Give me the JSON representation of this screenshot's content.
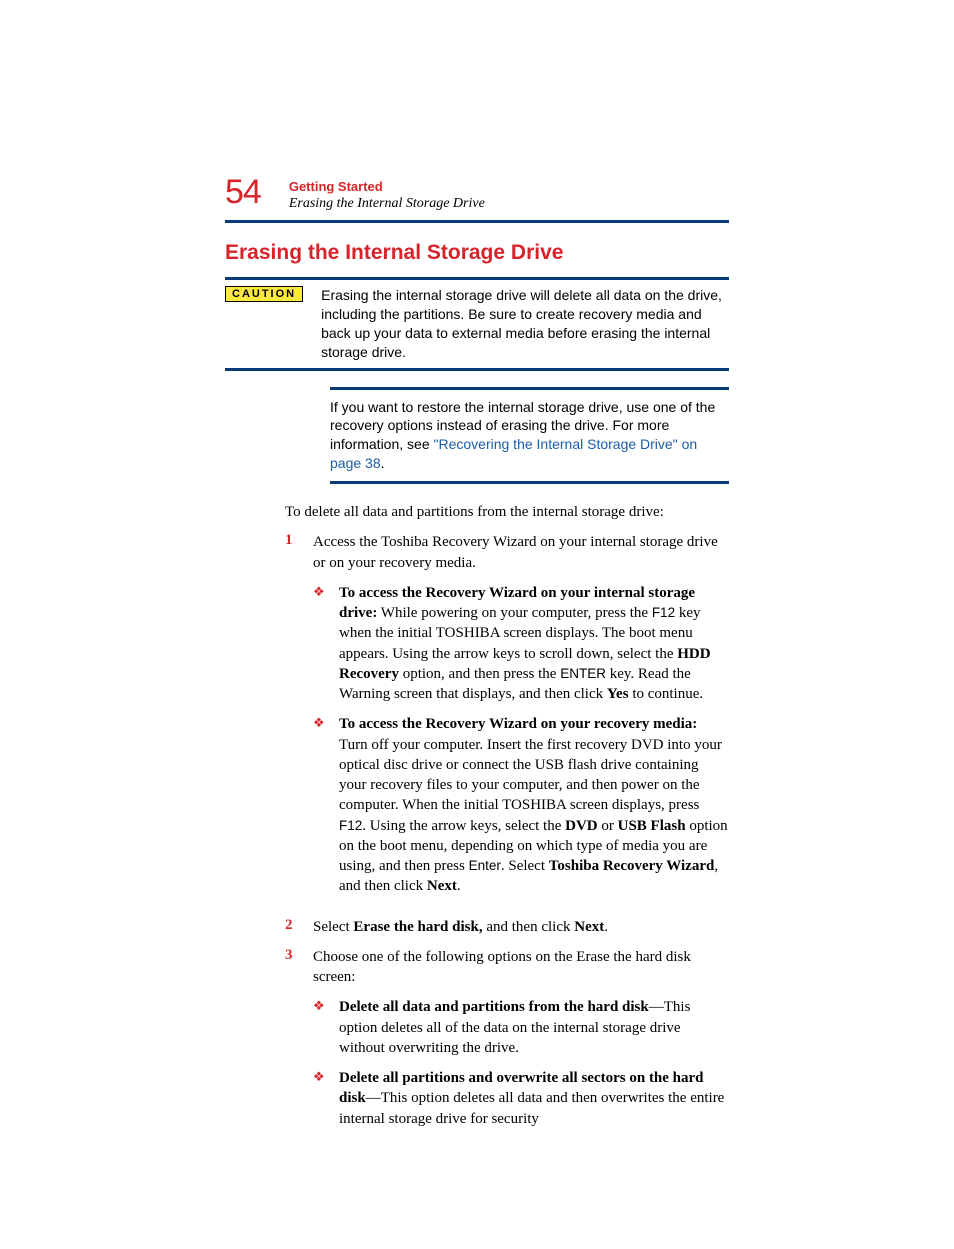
{
  "page_number": "54",
  "breadcrumb": "Getting Started",
  "subheading": "Erasing the Internal Storage Drive",
  "section_title": "Erasing the Internal Storage Drive",
  "caution": {
    "label": "CAUTION",
    "text": "Erasing the internal storage drive will delete all data on the drive, including the partitions. Be sure to create recovery media and back up your data to external media before erasing the internal storage drive."
  },
  "note": {
    "prefix": "If you want to restore the internal storage drive, use one of the recovery options instead of erasing the drive. For more information, see ",
    "link": "\"Recovering the Internal Storage Drive\" on page 38",
    "suffix": "."
  },
  "intro": "To delete all data and partitions from the internal storage drive:",
  "steps": {
    "s1": {
      "num": "1",
      "text": "Access the Toshiba Recovery Wizard on your internal storage drive or on your recovery media.",
      "sub_a": {
        "bold1": "To access the Recovery Wizard on your internal storage drive:",
        "t1": " While powering on your computer, press the ",
        "key1": "F12",
        "t2": " key when the initial TOSHIBA screen displays. The boot menu appears. Using the arrow keys to scroll down, select the ",
        "bold2": "HDD Recovery",
        "t3": " option, and then press the ",
        "key2": "ENTER",
        "t4": " key. Read the Warning screen that displays, and then click ",
        "bold3": "Yes",
        "t5": " to continue."
      },
      "sub_b": {
        "bold1": "To access the Recovery Wizard on your recovery media:",
        "t1": " Turn off your computer. Insert the first recovery DVD into your optical disc drive or connect the USB flash drive containing your recovery files to your computer, and then power on the computer. When the initial TOSHIBA screen displays, press ",
        "key1": "F12",
        "t2": ". Using the arrow keys, select the ",
        "bold2": "DVD",
        "t2b": " or ",
        "bold3": "USB Flash",
        "t3": " option on the boot menu, depending on which type of media you are using, and then press ",
        "key2": "Enter",
        "t4": ". Select ",
        "bold4": "Toshiba Recovery Wizard",
        "t5": ", and then click ",
        "bold5": "Next",
        "t6": "."
      }
    },
    "s2": {
      "num": "2",
      "t1": "Select ",
      "bold1": "Erase the hard disk,",
      "t2": " and then click ",
      "bold2": "Next",
      "t3": "."
    },
    "s3": {
      "num": "3",
      "text": "Choose one of the following options on the Erase the hard disk screen:",
      "sub_a": {
        "bold1": "Delete all data and partitions from the hard disk",
        "t1": "—This option deletes all of the data on the internal storage drive without overwriting the drive."
      },
      "sub_b": {
        "bold1": "Delete all partitions and overwrite all sectors on the hard disk",
        "t1": "—This option deletes all data and then overwrites the entire internal storage drive for security"
      }
    }
  }
}
